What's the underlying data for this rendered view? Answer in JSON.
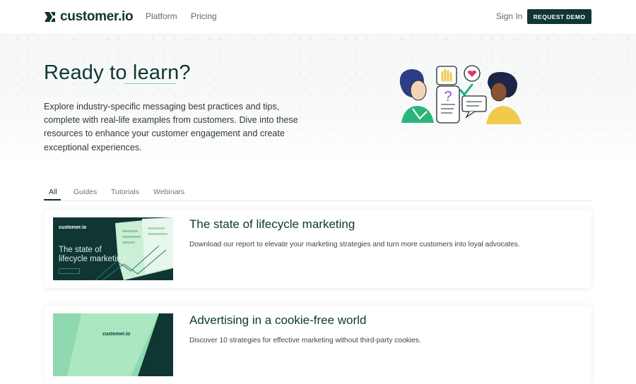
{
  "header": {
    "logo_text": "customer.io",
    "nav": [
      {
        "label": "Platform"
      },
      {
        "label": "Pricing"
      }
    ],
    "sign_in": "Sign In",
    "cta": "REQUEST DEMO"
  },
  "hero": {
    "title": "Ready to learn?",
    "description": "Explore industry-specific messaging best practices and tips, complete with real-life examples from customers. Dive into these resources to enhance your customer engagement and create exceptional experiences."
  },
  "tabs": [
    {
      "label": "All",
      "active": true
    },
    {
      "label": "Guides"
    },
    {
      "label": "Tutorials"
    },
    {
      "label": "Webinars"
    }
  ],
  "cards": [
    {
      "title": "The state of lifecycle marketing",
      "description": "Download our report to elevate your marketing strategies and turn more customers into loyal advocates.",
      "thumbnail": {
        "logo": "customer.io",
        "title": "The state of lifecycle marketing"
      }
    },
    {
      "title": "Advertising in a cookie-free world",
      "description": "Discover 10 strategies for effective marketing without third-party cookies.",
      "thumbnail": {
        "logo": "customer.io"
      }
    }
  ],
  "colors": {
    "brand": "#0f3633",
    "accent": "#7ed9a4"
  }
}
